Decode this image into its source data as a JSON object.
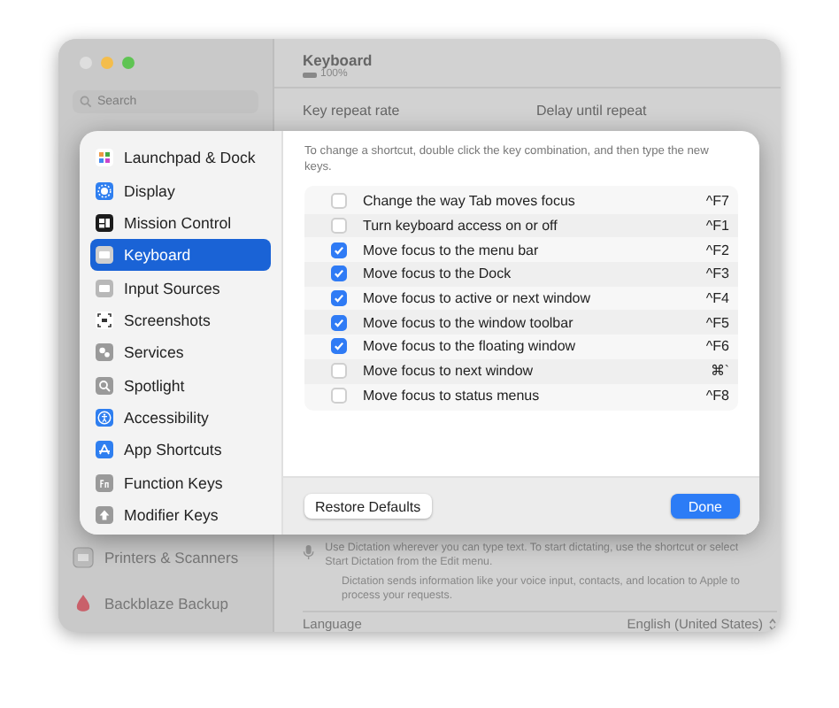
{
  "window": {
    "controls": [
      {
        "color": "#dedede"
      },
      {
        "color": "#f4bd4c"
      },
      {
        "color": "#5fc453"
      }
    ],
    "sidebar": {
      "search": {
        "placeholder": "Search"
      },
      "items": [
        {
          "label": "Printers & Scanners"
        },
        {
          "label": "Backblaze Backup"
        }
      ]
    },
    "main": {
      "title": "Keyboard",
      "battery": "100%",
      "labels": [
        "Key repeat rate",
        "Delay until repeat"
      ],
      "dictation_text": "Use Dictation wherever you can type text. To start dictating, use the shortcut or select Start Dictation from the Edit menu.",
      "privacy_text": "Dictation sends information like your voice input, contacts, and location to Apple to process your requests.",
      "language": {
        "label": "Language",
        "value": "English (United States)"
      }
    }
  },
  "sheet": {
    "sidebar": [
      {
        "label": "Launchpad & Dock",
        "selected": false
      },
      {
        "label": "Display",
        "selected": false
      },
      {
        "label": "Mission Control",
        "selected": false
      },
      {
        "label": "Keyboard",
        "selected": true
      },
      {
        "label": "Input Sources",
        "selected": false
      },
      {
        "label": "Screenshots",
        "selected": false
      },
      {
        "label": "Services",
        "selected": false
      },
      {
        "label": "Spotlight",
        "selected": false
      },
      {
        "label": "Accessibility",
        "selected": false
      },
      {
        "label": "App Shortcuts",
        "selected": false
      },
      {
        "label": "Function Keys",
        "selected": false
      },
      {
        "label": "Modifier Keys",
        "selected": false
      }
    ],
    "instructions": "To change a shortcut, double click the key combination, and then type the new keys.",
    "shortcuts": [
      {
        "label": "Change the way Tab moves focus",
        "checked": false,
        "keys": "^F7"
      },
      {
        "label": "Turn keyboard access on or off",
        "checked": false,
        "keys": "^F1"
      },
      {
        "label": "Move focus to the menu bar",
        "checked": true,
        "keys": "^F2"
      },
      {
        "label": "Move focus to the Dock",
        "checked": true,
        "keys": "^F3"
      },
      {
        "label": "Move focus to active or next window",
        "checked": true,
        "keys": "^F4"
      },
      {
        "label": "Move focus to the window toolbar",
        "checked": true,
        "keys": "^F5"
      },
      {
        "label": "Move focus to the floating window",
        "checked": true,
        "keys": "^F6"
      },
      {
        "label": "Move focus to next window",
        "checked": false,
        "keys": "⌘`"
      },
      {
        "label": "Move focus to status menus",
        "checked": false,
        "keys": "^F8"
      }
    ],
    "buttons": {
      "restore": "Restore Defaults",
      "done": "Done"
    }
  }
}
